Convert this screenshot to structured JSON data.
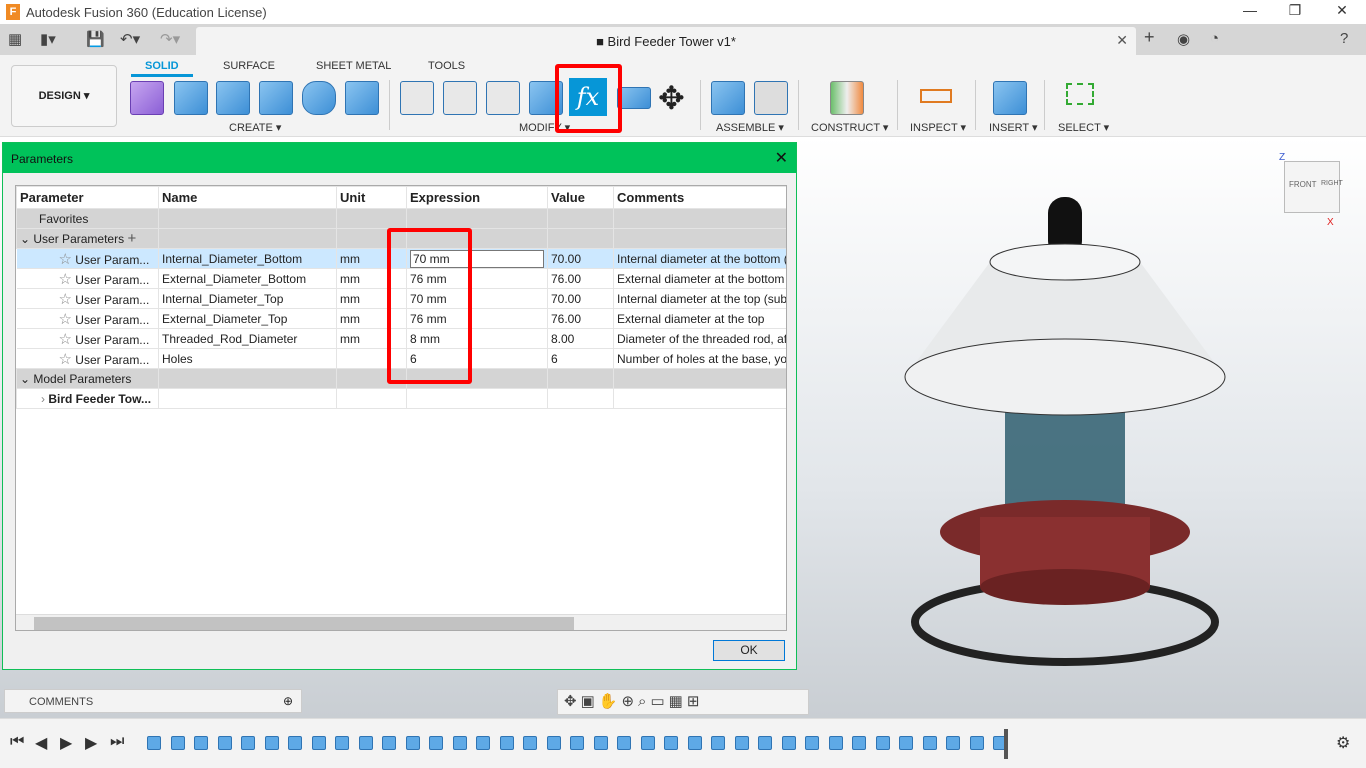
{
  "window": {
    "app_title": "Autodesk Fusion 360 (Education License)",
    "doc_title": "Bird Feeder Tower v1*"
  },
  "toolbar": {
    "workspace": "DESIGN ▾",
    "tabs": [
      "SOLID",
      "SURFACE",
      "SHEET METAL",
      "TOOLS"
    ],
    "groups": [
      "CREATE ▾",
      "MODIFY ▾",
      "ASSEMBLE ▾",
      "CONSTRUCT ▾",
      "INSPECT ▾",
      "INSERT ▾",
      "SELECT ▾"
    ],
    "fx_label": "fx"
  },
  "dialog": {
    "title": "Parameters",
    "columns": [
      "Parameter",
      "Name",
      "Unit",
      "Expression",
      "Value",
      "Comments"
    ],
    "favorites": "Favorites",
    "user_parameters": "User Parameters",
    "model_parameters": "Model Parameters",
    "model_child": "Bird Feeder Tow...",
    "rows": [
      {
        "param": "User Param...",
        "name": "Internal_Diameter_Bottom",
        "unit": "mm",
        "expression": "70 mm",
        "value": "70.00",
        "comment": "Internal diameter at the bottom ("
      },
      {
        "param": "User Param...",
        "name": "External_Diameter_Bottom",
        "unit": "mm",
        "expression": "76 mm",
        "value": "76.00",
        "comment": "External diameter at the bottom"
      },
      {
        "param": "User Param...",
        "name": "Internal_Diameter_Top",
        "unit": "mm",
        "expression": "70 mm",
        "value": "70.00",
        "comment": "Internal diameter at the top (subt"
      },
      {
        "param": "User Param...",
        "name": "External_Diameter_Top",
        "unit": "mm",
        "expression": "76 mm",
        "value": "76.00",
        "comment": "External diameter at the top"
      },
      {
        "param": "User Param...",
        "name": "Threaded_Rod_Diameter",
        "unit": "mm",
        "expression": "8 mm",
        "value": "8.00",
        "comment": "Diameter of the threaded rod, aft"
      },
      {
        "param": "User Param...",
        "name": "Holes",
        "unit": "",
        "expression": "6",
        "value": "6",
        "comment": "Number of holes at the base, you"
      }
    ],
    "ok": "OK"
  },
  "comments_panel": "COMMENTS",
  "viewcube": {
    "front": "FRONT",
    "right": "RIGHT",
    "z": "Z",
    "x": "X"
  },
  "colors": {
    "accent": "#0696d7",
    "dialog_header": "#00c25a",
    "highlight": "#ff0000"
  }
}
